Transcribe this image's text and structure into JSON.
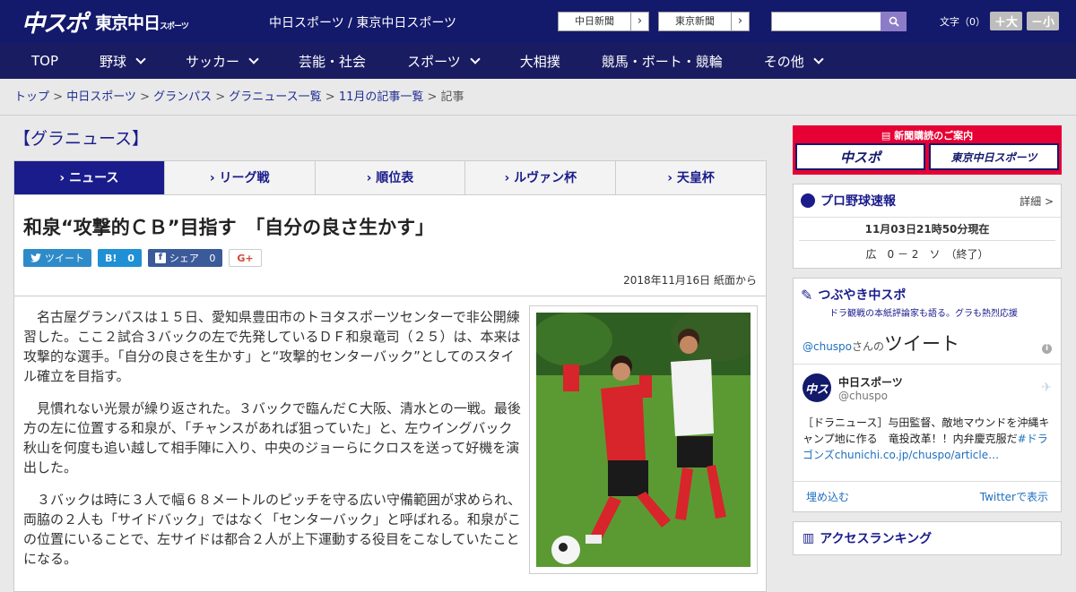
{
  "header": {
    "logo_main": "中スポ",
    "logo_tokyo": "東京中日",
    "logo_tokyo_small": "スポーツ",
    "site_links": "中日スポーツ / 東京中日スポーツ",
    "paper_buttons": [
      {
        "label": "中日新聞",
        "arrow": "›"
      },
      {
        "label": "東京新聞",
        "arrow": "›"
      }
    ],
    "search_placeholder": "",
    "font_label": "文字（0）",
    "font_larger": "＋大",
    "font_smaller": "－小"
  },
  "nav": {
    "items": [
      {
        "label": "TOP"
      },
      {
        "label": "野球"
      },
      {
        "label": "サッカー"
      },
      {
        "label": "芸能・社会"
      },
      {
        "label": "スポーツ"
      },
      {
        "label": "大相撲"
      },
      {
        "label": "競馬・ボート・競輪"
      },
      {
        "label": "その他"
      }
    ]
  },
  "breadcrumb": {
    "items": [
      "トップ",
      "中日スポーツ",
      "グランパス",
      "グラニュース一覧",
      "11月の記事一覧"
    ],
    "current": "記事",
    "separator": " > "
  },
  "main": {
    "section_title": "【グラニュース】",
    "tabs": [
      {
        "label": "› ニュース"
      },
      {
        "label": "› リーグ戦"
      },
      {
        "label": "› 順位表"
      },
      {
        "label": "› ルヴァン杯"
      },
      {
        "label": "› 天皇杯"
      }
    ],
    "headline": "和泉“攻撃的ＣＢ”目指す　「自分の良さ生かす」",
    "share": {
      "tweet": "ツイート",
      "hatena": "B!",
      "hatena_count": "0",
      "facebook": "シェア",
      "facebook_count": "0",
      "gplus": "G+"
    },
    "date": "2018年11月16日 紙面から",
    "paragraphs": [
      "名古屋グランパスは１５日、愛知県豊田市のトヨタスポーツセンターで非公開練習した。ここ２試合３バックの左で先発しているＤＦ和泉竜司（２５）は、本来は攻撃的な選手。「自分の良さを生かす」と“攻撃的センターバック”としてのスタイル確立を目指す。",
      "見慣れない光景が繰り返された。３バックで臨んだＣ大阪、清水との一戦。最後方の左に位置する和泉が、「チャンスがあれば狙っていた」と、左ウイングバック秋山を何度も追い越して相手陣に入り、中央のジョーらにクロスを送って好機を演出した。",
      "３バックは時に３人で幅６８メートルのピッチを守る広い守備範囲が求められ、両脇の２人も「サイドバック」ではなく「センターバック」と呼ばれる。和泉がこの位置にいることで、左サイドは都合２人が上下運動する役目をこなしていたことになる。"
    ]
  },
  "side": {
    "subscribe_title": "新聞購読のご案内",
    "subscribe_logos": [
      "中スポ",
      "東京中日スポーツ"
    ],
    "baseball": {
      "title": "プロ野球速報",
      "more": "詳細 >",
      "time": "11月03日21時50分現在",
      "game": "広　0 － 2　ソ　（終了）"
    },
    "tubuyaki": {
      "title": "つぶやき中スポ",
      "subtitle": "ドラ観戦の本紙評論家も語る。グラも熱烈応援",
      "user": "@chuspo",
      "user_suffix": "さんの",
      "label": "ツイート",
      "account_name": "中日スポーツ",
      "account_handle": "@chuspo",
      "avatar": "中ス",
      "tweet_text": "［ドラニュース］与田監督、敵地マウンドを沖縄キャンプ地に作る　竜投改革！！内弁慶克服だ",
      "tweet_link": "#ドラゴンズchunichi.co.jp/chuspo/article…",
      "embed": "埋め込む",
      "view_on_twitter": "Twitterで表示"
    },
    "ranking_title": "アクセスランキング"
  }
}
